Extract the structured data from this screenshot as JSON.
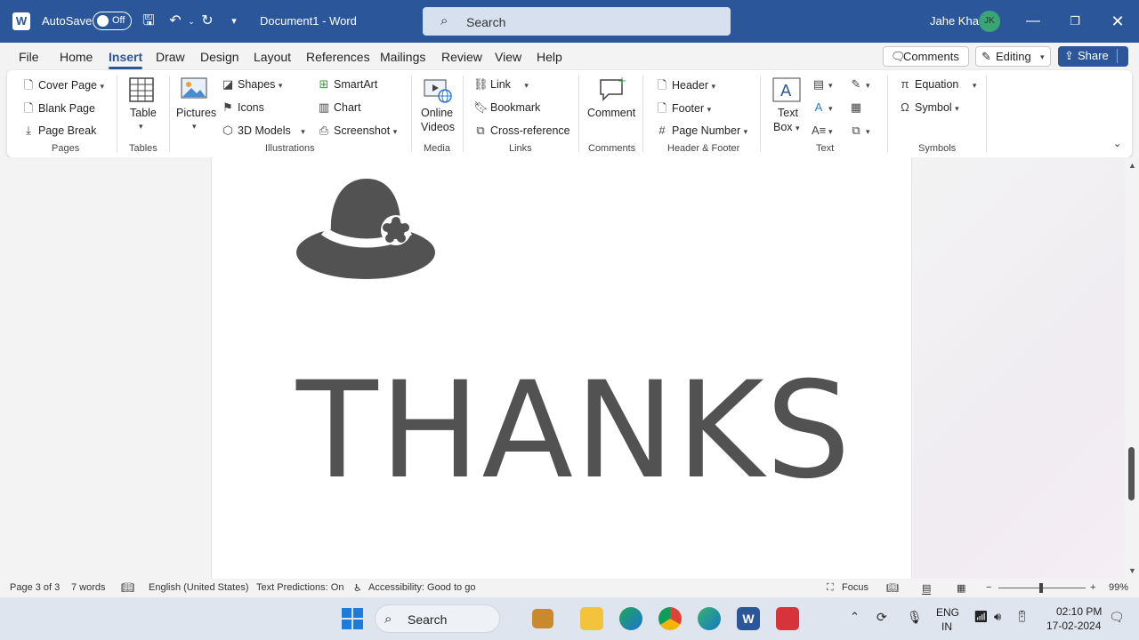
{
  "titlebar": {
    "autosave_label": "AutoSave",
    "autosave_state": "Off",
    "document_title": "Document1",
    "separator": "-",
    "app_name": "Word",
    "search_placeholder": "Search",
    "user_name": "Jahe Kha",
    "user_initials": "JK"
  },
  "menu": {
    "tabs": [
      "File",
      "Home",
      "Insert",
      "Draw",
      "Design",
      "Layout",
      "References",
      "Mailings",
      "Review",
      "View",
      "Help"
    ],
    "active_tab": "Insert",
    "comments_label": "Comments",
    "editing_label": "Editing",
    "share_label": "Share"
  },
  "ribbon": {
    "pages": {
      "cover_page": "Cover Page",
      "blank_page": "Blank Page",
      "page_break": "Page Break",
      "group": "Pages"
    },
    "tables": {
      "table": "Table",
      "group": "Tables"
    },
    "illustrations": {
      "pictures": "Pictures",
      "shapes": "Shapes",
      "icons": "Icons",
      "models_3d": "3D Models",
      "smartart": "SmartArt",
      "chart": "Chart",
      "screenshot": "Screenshot",
      "group": "Illustrations"
    },
    "media": {
      "online_videos_1": "Online",
      "online_videos_2": "Videos",
      "group": "Media"
    },
    "links": {
      "link": "Link",
      "bookmark": "Bookmark",
      "cross_reference": "Cross-reference",
      "group": "Links"
    },
    "comments": {
      "comment": "Comment",
      "group": "Comments"
    },
    "header_footer": {
      "header": "Header",
      "footer": "Footer",
      "page_number": "Page Number",
      "group": "Header & Footer"
    },
    "text": {
      "text_box_1": "Text",
      "text_box_2": "Box",
      "group": "Text"
    },
    "symbols": {
      "equation": "Equation",
      "symbol": "Symbol",
      "group": "Symbols"
    }
  },
  "document": {
    "heading_text": "THANKS"
  },
  "statusbar": {
    "page": "Page 3 of 3",
    "words": "7 words",
    "language": "English (United States)",
    "text_predictions": "Text Predictions: On",
    "accessibility": "Accessibility: Good to go",
    "focus": "Focus",
    "zoom": "99%"
  },
  "taskbar": {
    "search_label": "Search",
    "lang_line1": "ENG",
    "lang_line2": "IN",
    "time": "02:10 PM",
    "date": "17-02-2024"
  },
  "colors": {
    "word_blue": "#2b579a",
    "avatar_green": "#3aa475",
    "thanks_gray": "#525252"
  }
}
